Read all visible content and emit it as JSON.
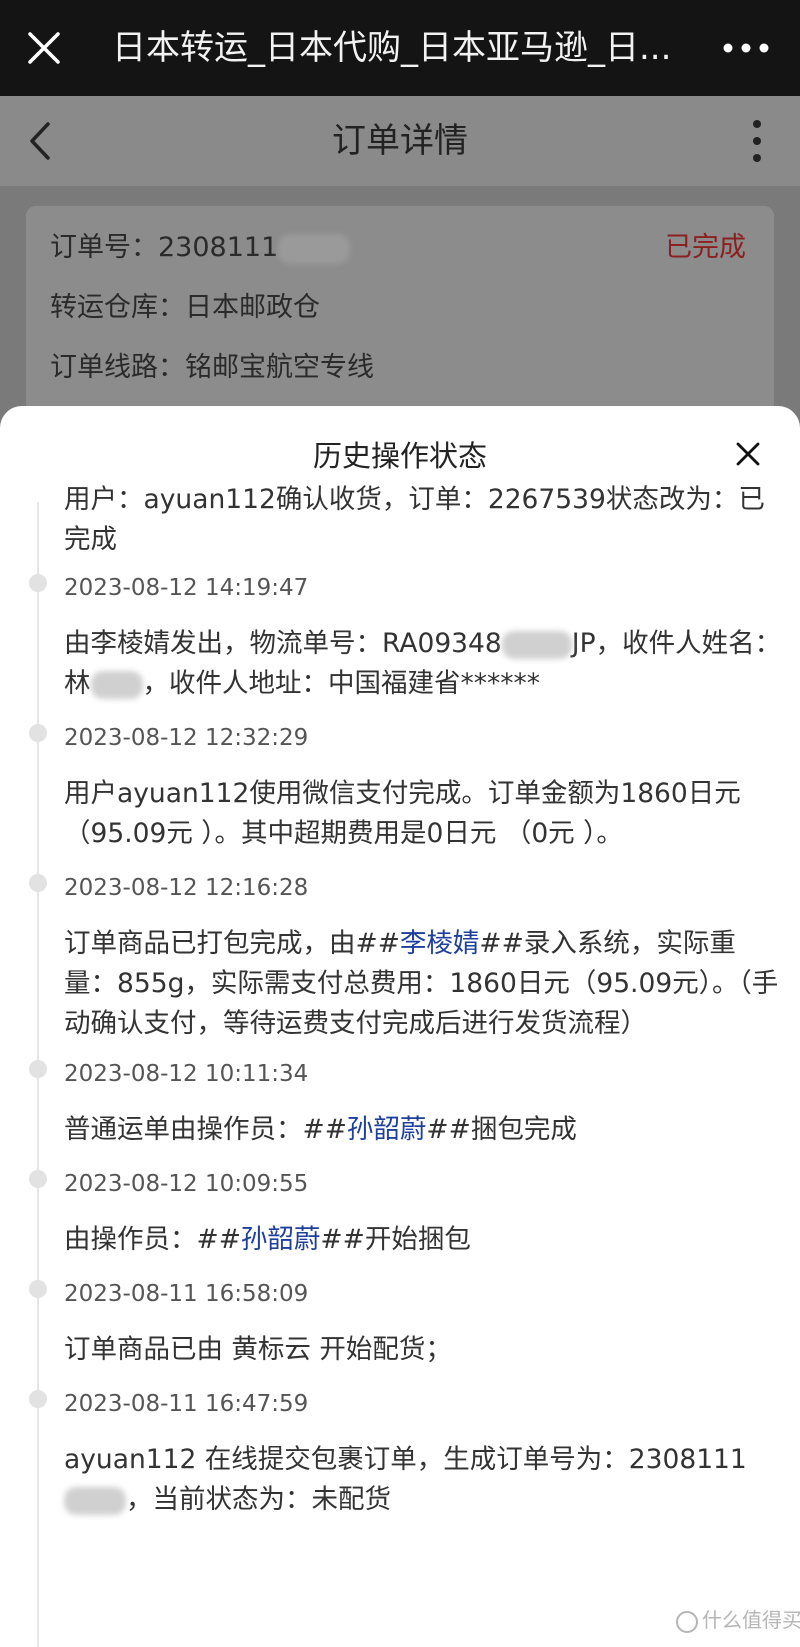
{
  "browser": {
    "title": "日本转运_日本代购_日本亚马逊_日..."
  },
  "header": {
    "title": "订单详情"
  },
  "order": {
    "number_label": "订单号：",
    "number_value": "2308111",
    "status": "已完成",
    "warehouse_label": "转运仓库：",
    "warehouse_value": "日本邮政仓",
    "route_label": "订单线路：",
    "route_value": "铭邮宝航空专线"
  },
  "sheet": {
    "title": "历史操作状态",
    "entries": [
      {
        "message": "用户：ayuan112确认收货，订单：2267539状态改为：已完成"
      },
      {
        "time": "2023-08-12 14:19:47",
        "message_a": "由李棱婧发出，物流单号：RA09348",
        "message_b": "JP，收件人姓名：林",
        "message_c": "，收件人地址：中国福建省******"
      },
      {
        "time": "2023-08-12 12:32:29",
        "message": "用户ayuan112使用微信支付完成。订单金额为1860日元（95.09元 ）。其中超期费用是0日元 （0元 ）。"
      },
      {
        "time": "2023-08-12 12:16:28",
        "message_a": "订单商品已打包完成，由##",
        "name": "李棱婧",
        "message_b": "##录入系统，实际重量：855g，实际需支付总费用：1860日元（95.09元）。（手动确认支付，等待运费支付完成后进行发货流程）"
      },
      {
        "time": "2023-08-12 10:11:34",
        "message_a": "普通运单由操作员：##",
        "name": "孙韶蔚",
        "message_b": "##捆包完成"
      },
      {
        "time": "2023-08-12 10:09:55",
        "message_a": "由操作员：##",
        "name": "孙韶蔚",
        "message_b": "##开始捆包"
      },
      {
        "time": "2023-08-11 16:58:09",
        "message": "订单商品已由 黄标云 开始配货；"
      },
      {
        "time": "2023-08-11 16:47:59",
        "message_a": "ayuan112 在线提交包裹订单，生成订单号为：2308111",
        "message_b": "，当前状态为：未配货"
      }
    ]
  },
  "watermark": {
    "text": "什么值得买"
  }
}
